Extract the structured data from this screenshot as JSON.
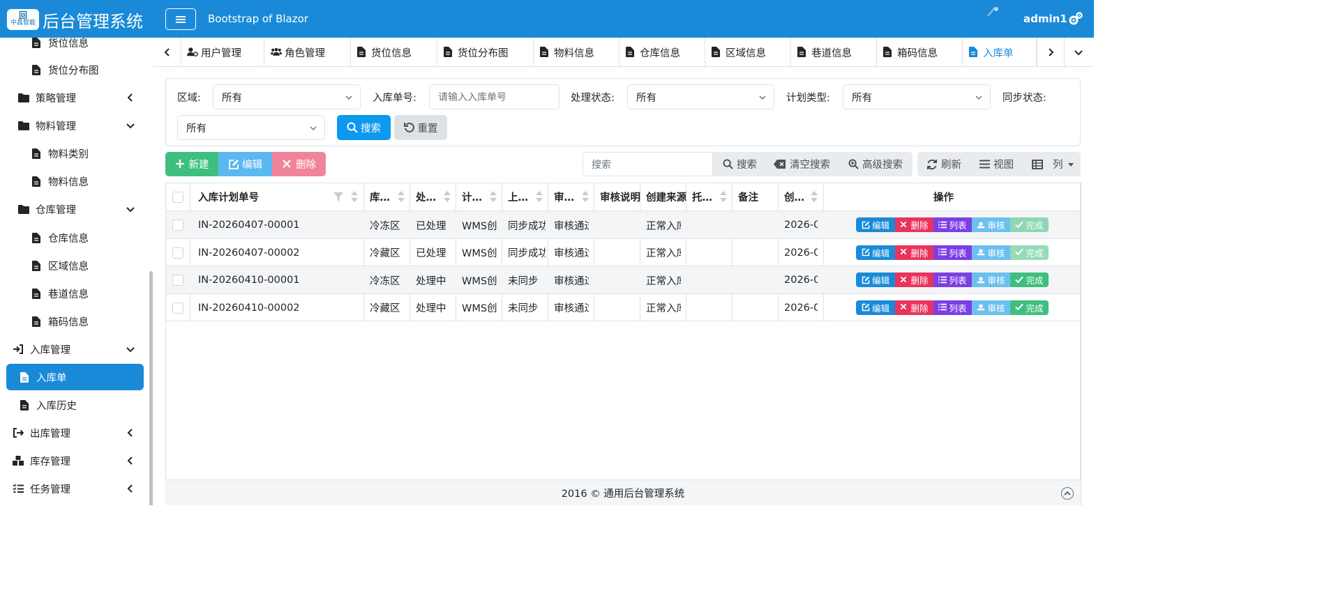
{
  "header": {
    "logo_text": "中昌智能",
    "app_title": "后台管理系统",
    "subtitle": "Bootstrap of Blazor",
    "username": "admin1",
    "icons": {
      "menu": "hamburger-icon",
      "settings": "gear-icon"
    },
    "color": "#1a8ad8"
  },
  "sidebar": {
    "items": [
      {
        "label": "货位信息",
        "icon": "file-icon",
        "level": 2
      },
      {
        "label": "货位分布图",
        "icon": "file-icon",
        "level": 2
      },
      {
        "label": "策略管理",
        "icon": "folder-icon",
        "level": 1,
        "chevron": "left"
      },
      {
        "label": "物料管理",
        "icon": "folder-icon",
        "level": 1,
        "chevron": "down"
      },
      {
        "label": "物料类别",
        "icon": "file-icon",
        "level": 2
      },
      {
        "label": "物料信息",
        "icon": "file-icon",
        "level": 2
      },
      {
        "label": "仓库管理",
        "icon": "folder-icon",
        "level": 1,
        "chevron": "down"
      },
      {
        "label": "仓库信息",
        "icon": "file-icon",
        "level": 2
      },
      {
        "label": "区域信息",
        "icon": "file-icon",
        "level": 2
      },
      {
        "label": "巷道信息",
        "icon": "file-icon",
        "level": 2
      },
      {
        "label": "箱码信息",
        "icon": "file-icon",
        "level": 2
      },
      {
        "label": "入库管理",
        "icon": "sign-in-icon",
        "level": 1,
        "chevron": "down"
      },
      {
        "label": "入库单",
        "icon": "file-icon",
        "level": 2,
        "active": true
      },
      {
        "label": "入库历史",
        "icon": "file-icon",
        "level": 2
      },
      {
        "label": "出库管理",
        "icon": "sign-out-icon",
        "level": 1,
        "chevron": "left"
      },
      {
        "label": "库存管理",
        "icon": "boxes-icon",
        "level": 1,
        "chevron": "left"
      },
      {
        "label": "任务管理",
        "icon": "list-icon",
        "level": 1,
        "chevron": "left"
      }
    ]
  },
  "tabs": [
    {
      "label": "用户管理",
      "icon": "user-cog-icon"
    },
    {
      "label": "角色管理",
      "icon": "users-icon"
    },
    {
      "label": "货位信息",
      "icon": "file-icon"
    },
    {
      "label": "货位分布图",
      "icon": "file-icon"
    },
    {
      "label": "物料信息",
      "icon": "file-icon"
    },
    {
      "label": "仓库信息",
      "icon": "file-icon"
    },
    {
      "label": "区域信息",
      "icon": "file-icon"
    },
    {
      "label": "巷道信息",
      "icon": "file-icon"
    },
    {
      "label": "箱码信息",
      "icon": "file-icon"
    },
    {
      "label": "入库单",
      "icon": "file-icon",
      "active": true
    }
  ],
  "search": {
    "area_label": "区域:",
    "area_value": "所有",
    "order_label": "入库单号:",
    "order_placeholder": "请输入入库单号",
    "status_label": "处理状态:",
    "status_value": "所有",
    "plan_label": "计划类型:",
    "plan_value": "所有",
    "sync_label": "同步状态:",
    "sync_value": "所有",
    "search_btn": "搜索",
    "reset_btn": "重置"
  },
  "toolbar": {
    "new_btn": "新建",
    "edit_btn": "编辑",
    "delete_btn": "删除",
    "search_placeholder": "搜索",
    "search_btn": "搜索",
    "clear_btn": "清空搜索",
    "advanced_btn": "高级搜索",
    "refresh_btn": "刷新",
    "view_btn": "视图",
    "columns_btn": "列"
  },
  "table": {
    "headers": [
      "入库计划单号",
      "库…",
      "处…",
      "计…",
      "上…",
      "审…",
      "审核说明",
      "创建来源",
      "托…",
      "备注",
      "创…",
      "操作"
    ],
    "rows": [
      [
        "IN-20260407-00001",
        "冷冻区",
        "已处理",
        "WMS创",
        "同步成功",
        "审核通过",
        "",
        "正常入库",
        "",
        "",
        "2026-0"
      ],
      [
        "IN-20260407-00002",
        "冷藏区",
        "已处理",
        "WMS创",
        "同步成功",
        "审核通过",
        "",
        "正常入库",
        "",
        "",
        "2026-0"
      ],
      [
        "IN-20260410-00001",
        "冷冻区",
        "处理中",
        "WMS创",
        "未同步",
        "审核通过",
        "",
        "正常入库",
        "",
        "",
        "2026-0"
      ],
      [
        "IN-20260410-00002",
        "冷藏区",
        "处理中",
        "WMS创",
        "未同步",
        "审核通过",
        "",
        "正常入库",
        "",
        "",
        "2026-0"
      ]
    ],
    "row_actions": [
      "编辑",
      "删除",
      "列表",
      "审核",
      "完成"
    ]
  },
  "footer": {
    "text": "2016 © 通用后台管理系统"
  },
  "colors": {
    "primary": "#1a8ad8",
    "success": "#3fbf7f",
    "info": "#5cb8f0",
    "danger": "#f0637f",
    "action_edit": "#1a8ad8",
    "action_delete": "#e8345d",
    "action_list": "#7b3fe4",
    "action_audit": "#6cc0ee",
    "action_done": "#3fbf7f"
  }
}
